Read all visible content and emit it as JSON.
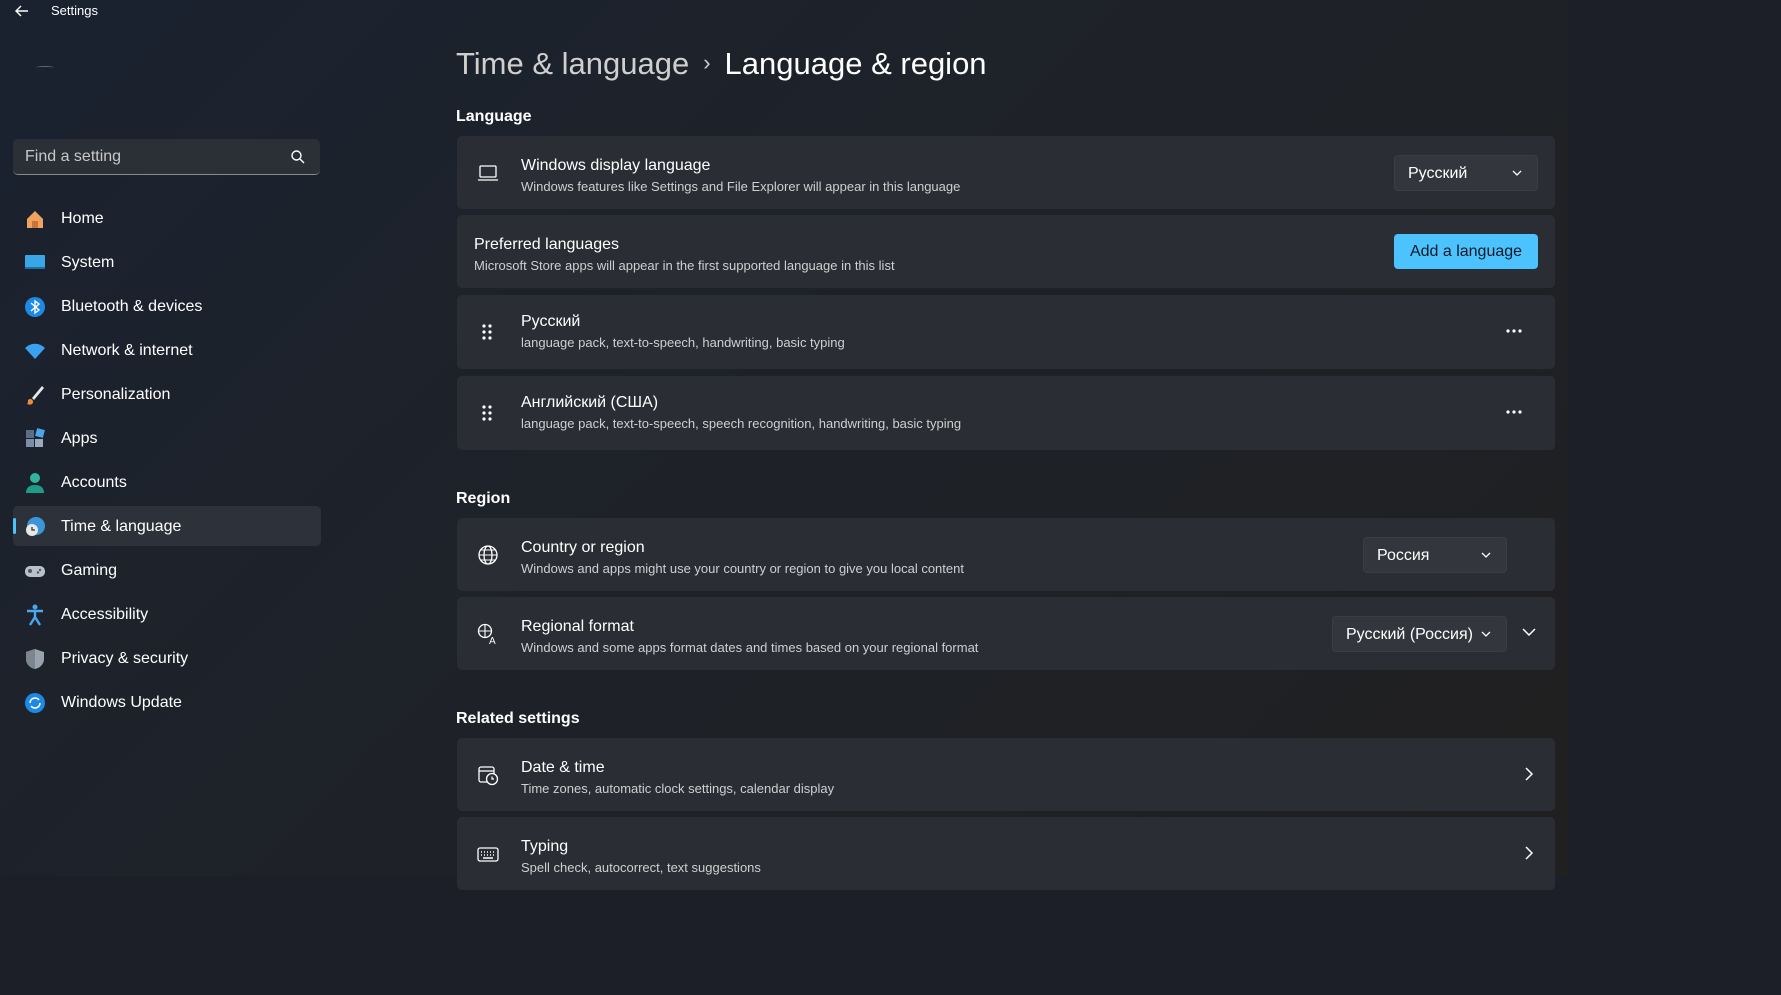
{
  "window": {
    "title": "Settings"
  },
  "sidebar": {
    "search": {
      "placeholder": "Find a setting"
    },
    "items": [
      {
        "label": "Home",
        "icon": "home-icon"
      },
      {
        "label": "System",
        "icon": "system-icon"
      },
      {
        "label": "Bluetooth & devices",
        "icon": "bluetooth-icon"
      },
      {
        "label": "Network & internet",
        "icon": "wifi-icon"
      },
      {
        "label": "Personalization",
        "icon": "brush-icon"
      },
      {
        "label": "Apps",
        "icon": "apps-icon"
      },
      {
        "label": "Accounts",
        "icon": "account-icon"
      },
      {
        "label": "Time & language",
        "icon": "globe-clock-icon",
        "active": true
      },
      {
        "label": "Gaming",
        "icon": "gamepad-icon"
      },
      {
        "label": "Accessibility",
        "icon": "accessibility-icon"
      },
      {
        "label": "Privacy & security",
        "icon": "shield-icon"
      },
      {
        "label": "Windows Update",
        "icon": "update-icon"
      }
    ]
  },
  "breadcrumb": {
    "parent": "Time & language",
    "separator": "›",
    "current": "Language & region"
  },
  "language": {
    "title": "Language",
    "display": {
      "title": "Windows display language",
      "desc": "Windows features like Settings and File Explorer will appear in this language",
      "value": "Русский"
    },
    "preferred": {
      "title": "Preferred languages",
      "desc": "Microsoft Store apps will appear in the first supported language in this list",
      "button": "Add a language"
    },
    "list": [
      {
        "name": "Русский",
        "features": "language pack, text-to-speech, handwriting, basic typing"
      },
      {
        "name": "Английский (США)",
        "features": "language pack, text-to-speech, speech recognition, handwriting, basic typing"
      }
    ]
  },
  "region": {
    "title": "Region",
    "country": {
      "title": "Country or region",
      "desc": "Windows and apps might use your country or region to give you local content",
      "value": "Россия"
    },
    "format": {
      "title": "Regional format",
      "desc": "Windows and some apps format dates and times based on your regional format",
      "value": "Русский (Россия)"
    }
  },
  "related": {
    "title": "Related settings",
    "datetime": {
      "title": "Date & time",
      "desc": "Time zones, automatic clock settings, calendar display"
    },
    "typing": {
      "title": "Typing",
      "desc": "Spell check, autocorrect, text suggestions"
    }
  },
  "colors": {
    "accent": "#4cc2ff",
    "card": "#2a2d33",
    "background": "#1c1f28"
  }
}
